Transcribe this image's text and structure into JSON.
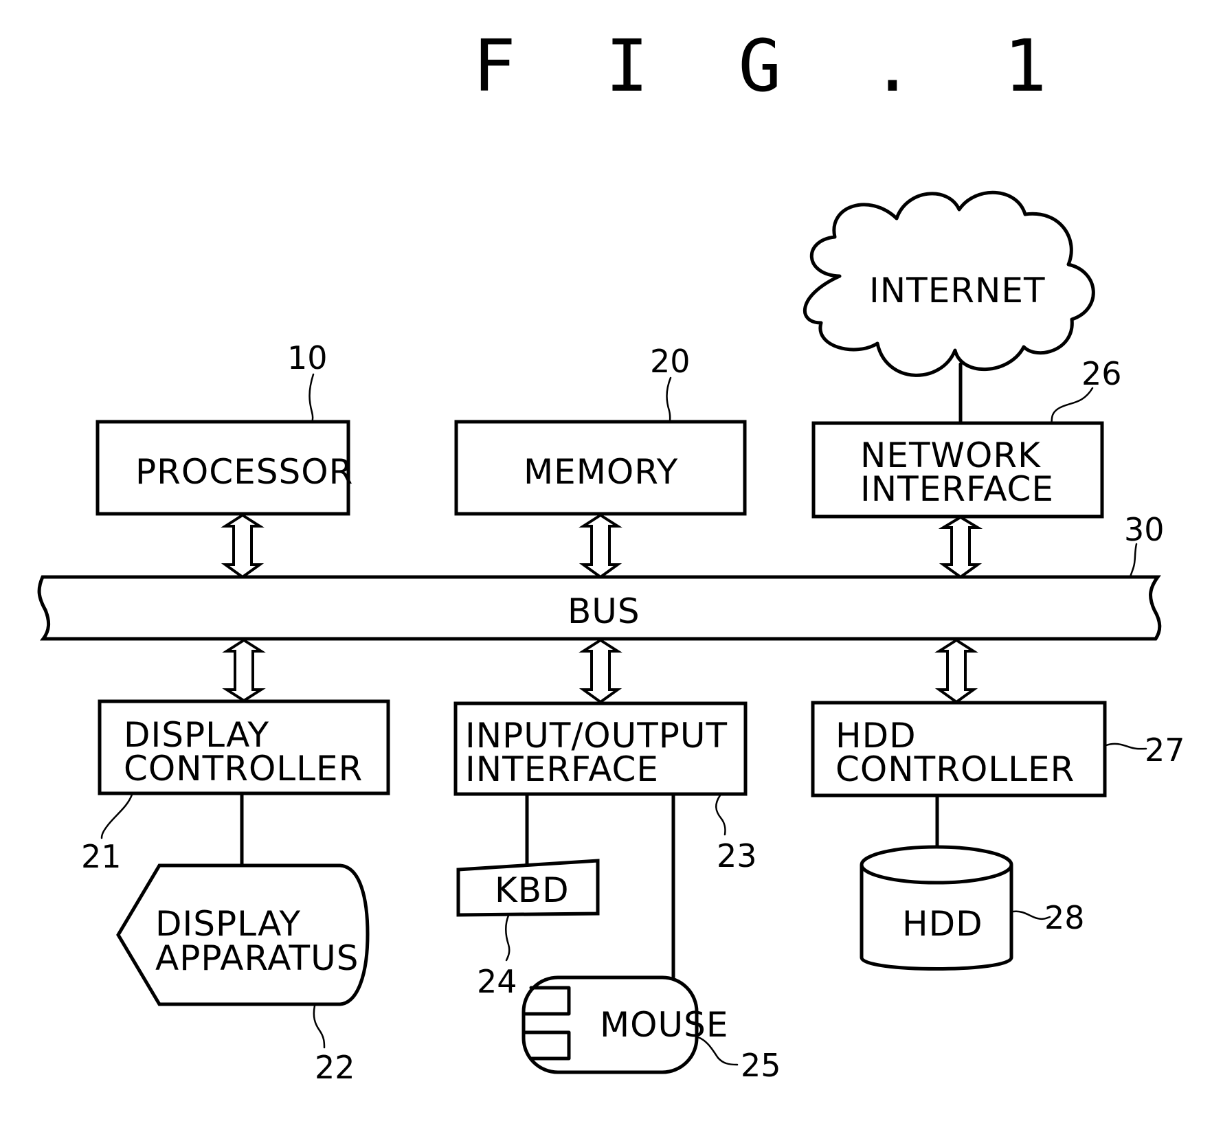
{
  "figure": {
    "title": "F I G . 1"
  },
  "components": {
    "processor": {
      "label": "PROCESSOR",
      "ref": "10"
    },
    "memory": {
      "label": "MEMORY",
      "ref": "20"
    },
    "network_interface": {
      "label_line1": "NETWORK",
      "label_line2": "INTERFACE",
      "ref": "26"
    },
    "internet": {
      "label": "INTERNET"
    },
    "bus": {
      "label": "BUS",
      "ref": "30"
    },
    "display_controller": {
      "label_line1": "DISPLAY",
      "label_line2": "CONTROLLER",
      "ref": "21"
    },
    "display_apparatus": {
      "label_line1": "DISPLAY",
      "label_line2": "APPARATUS",
      "ref": "22"
    },
    "io_interface": {
      "label_line1": "INPUT/OUTPUT",
      "label_line2": "INTERFACE",
      "ref": "23"
    },
    "keyboard": {
      "label": "KBD",
      "ref": "24"
    },
    "mouse": {
      "label": "MOUSE",
      "ref": "25"
    },
    "hdd_controller": {
      "label_line1": "HDD",
      "label_line2": "CONTROLLER",
      "ref": "27"
    },
    "hdd": {
      "label": "HDD",
      "ref": "28"
    }
  }
}
